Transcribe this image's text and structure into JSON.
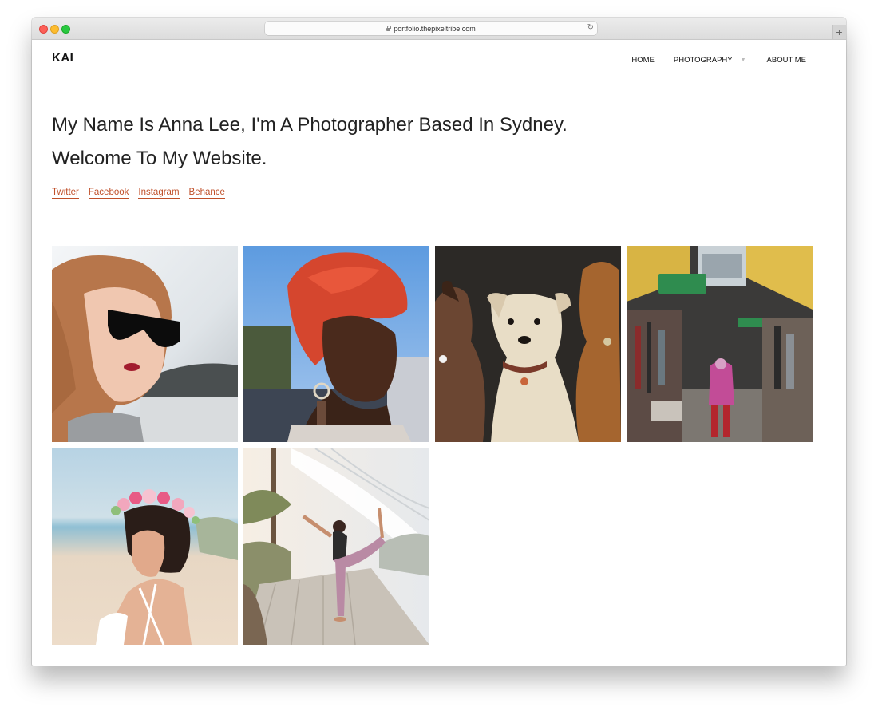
{
  "browser": {
    "url": "portfolio.thepixeltribe.com"
  },
  "site": {
    "logo": "KAI",
    "nav": [
      {
        "label": "HOME"
      },
      {
        "label": "PHOTOGRAPHY"
      },
      {
        "label": "ABOUT ME"
      }
    ]
  },
  "hero": {
    "line1": "My Name Is Anna Lee, I'm A Photographer Based In Sydney.",
    "line2": "Welcome To My Website."
  },
  "social": {
    "links": [
      "Twitter",
      "Facebook",
      "Instagram",
      "Behance"
    ]
  },
  "gallery": {
    "photos": [
      {
        "name": "woman-sunglasses-photo"
      },
      {
        "name": "woman-red-headwrap-photo"
      },
      {
        "name": "three-dogs-photo"
      },
      {
        "name": "street-market-photo"
      },
      {
        "name": "woman-flower-crown-photo"
      },
      {
        "name": "yoga-pose-photo"
      }
    ]
  },
  "colors": {
    "accent": "#c0502a",
    "text": "#222222"
  }
}
